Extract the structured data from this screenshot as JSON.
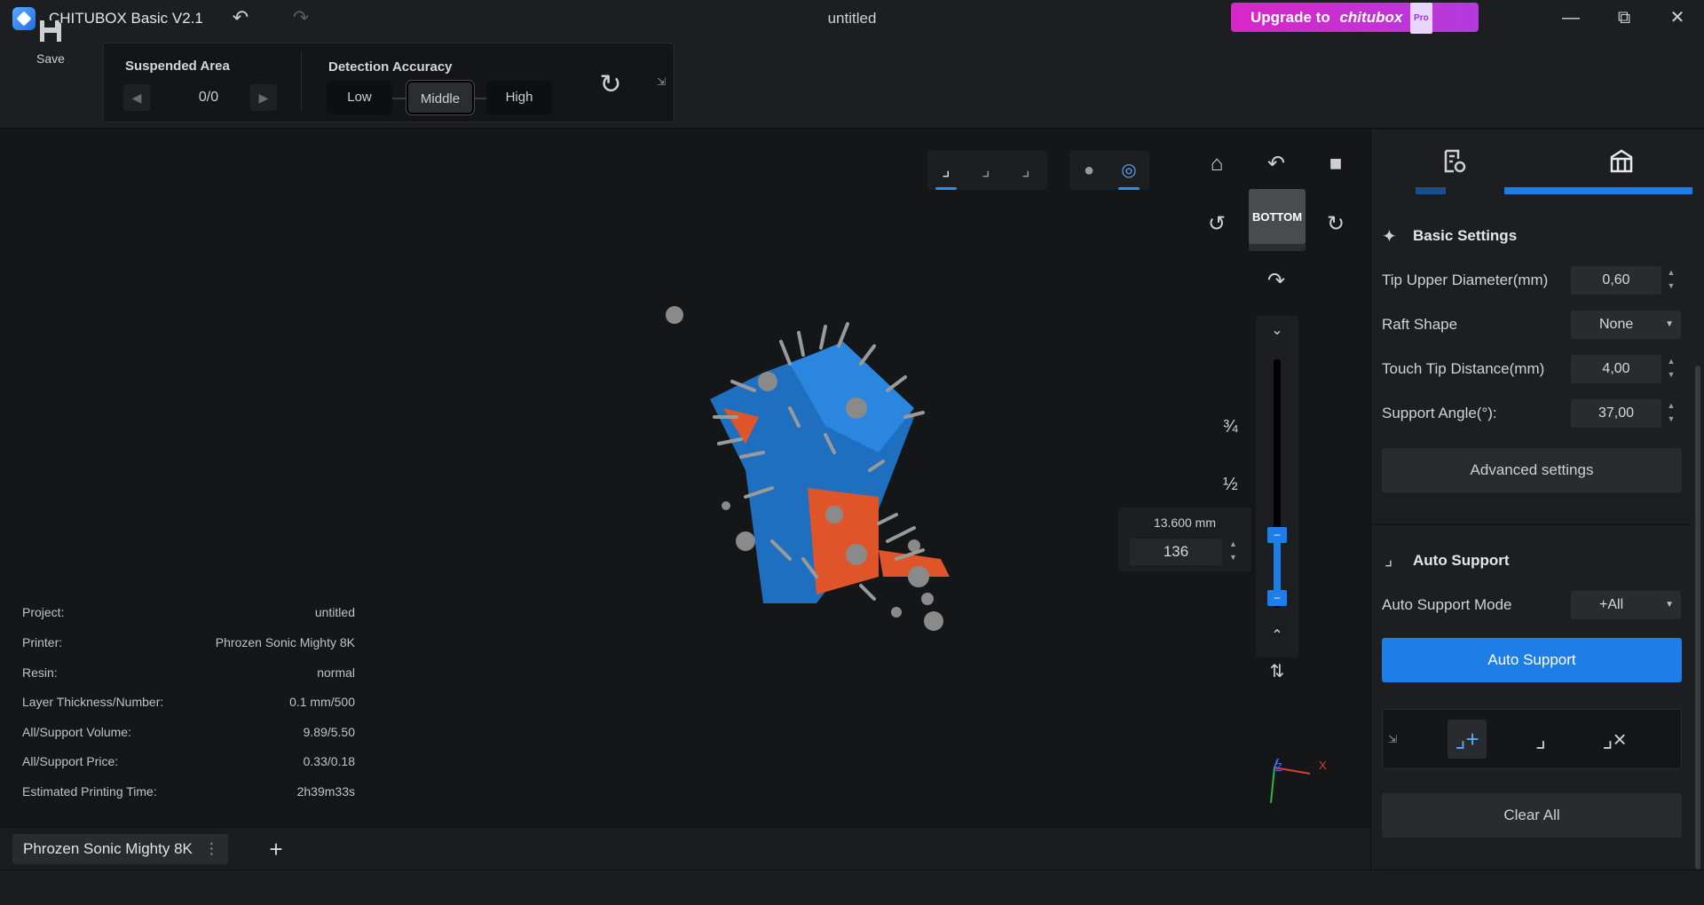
{
  "titlebar": {
    "app_title": "CHITUBOX Basic V2.1",
    "doc_title": "untitled",
    "upgrade_prefix": "Upgrade to",
    "upgrade_brand": "chitubox",
    "upgrade_pro": "Pro",
    "minimize": "—",
    "maximize": "⧉",
    "close": "✕"
  },
  "toolbar": {
    "save_label": "Save",
    "suspended_area_title": "Suspended Area",
    "suspended_counter": "0/0",
    "detection_accuracy_title": "Detection Accuracy",
    "accuracy_options": [
      "Low",
      "Middle",
      "High"
    ],
    "accuracy_selected": "Middle"
  },
  "viewport": {
    "cube_label": "BOTTOM",
    "frac_three_quarters": "¾",
    "frac_half": "½",
    "layer_height": "13.600 mm",
    "layer_number": "136",
    "axis_x": "X",
    "axis_z": "Z"
  },
  "info": {
    "rows": [
      {
        "label": "Project:",
        "value": "untitled"
      },
      {
        "label": "Printer:",
        "value": "Phrozen Sonic Mighty 8K"
      },
      {
        "label": "Resin:",
        "value": "normal"
      },
      {
        "label": "Layer Thickness/Number:",
        "value": "0.1 mm/500"
      },
      {
        "label": "All/Support Volume:",
        "value": "9.89/5.50"
      },
      {
        "label": "All/Support Price:",
        "value": "0.33/0.18"
      },
      {
        "label": "Estimated Printing Time:",
        "value": "2h39m33s"
      }
    ]
  },
  "bottom": {
    "printer_tab": "Phrozen Sonic Mighty 8K",
    "add_tab": "+"
  },
  "right_panel": {
    "basic_settings_title": "Basic Settings",
    "tip_upper_label": "Tip Upper Diameter(mm)",
    "tip_upper_value": "0,60",
    "raft_shape_label": "Raft Shape",
    "raft_shape_value": "None",
    "touch_tip_label": "Touch Tip Distance(mm)",
    "touch_tip_value": "4,00",
    "support_angle_label": "Support Angle(°):",
    "support_angle_value": "37,00",
    "advanced_settings": "Advanced settings",
    "auto_support_title": "Auto Support",
    "auto_support_mode_label": "Auto Support Mode",
    "auto_support_mode_value": "+All",
    "auto_support_button": "Auto Support",
    "clear_all_button": "Clear All"
  },
  "colors": {
    "accent": "#1e7ee8",
    "upgrade_start": "#d826c7",
    "upgrade_end": "#b33bde",
    "model_blue": "#1f6fc0",
    "model_orange": "#e0542a",
    "support_gray": "#8a8a8a"
  }
}
